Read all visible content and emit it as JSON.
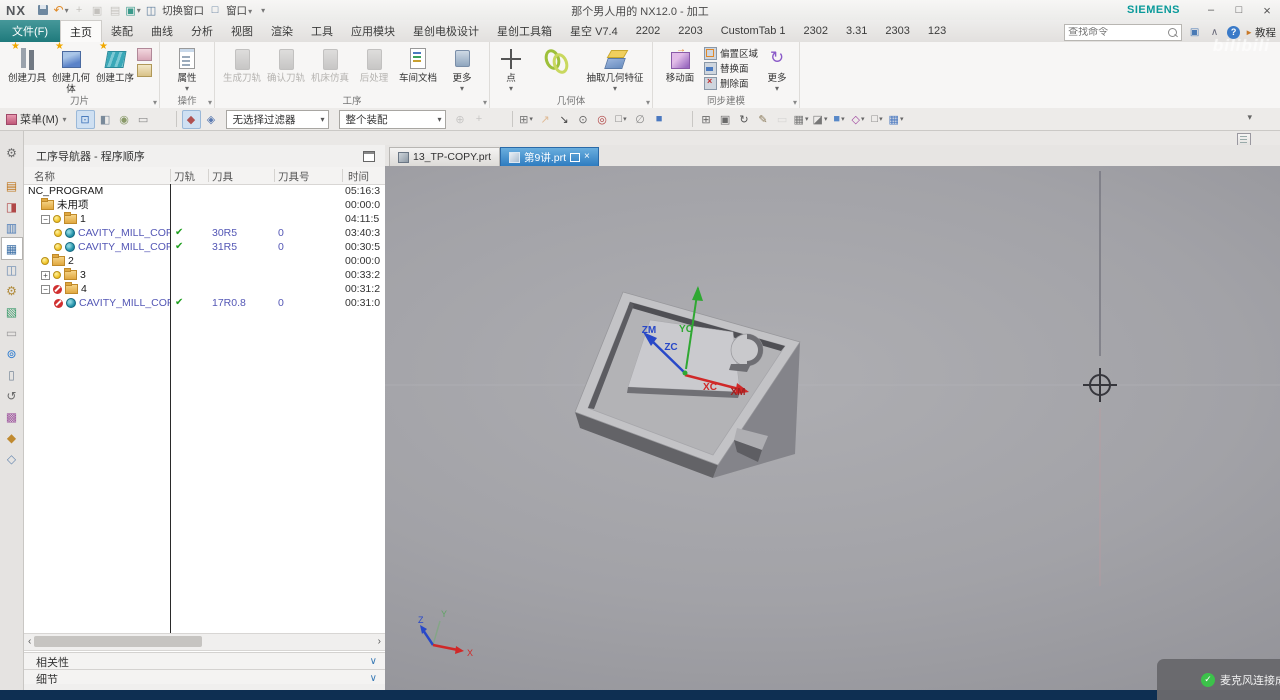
{
  "titlebar": {
    "logo": "NX",
    "title": "那个男人用的 NX12.0 - 加工",
    "brand": "SIEMENS",
    "switch_window": "切换窗口",
    "window_menu": "窗口"
  },
  "menu": {
    "file_tab": "文件(F)",
    "tabs": [
      {
        "label": "主页",
        "active": true
      },
      {
        "label": "装配"
      },
      {
        "label": "曲线"
      },
      {
        "label": "分析"
      },
      {
        "label": "视图"
      },
      {
        "label": "渲染"
      },
      {
        "label": "工具"
      },
      {
        "label": "应用模块"
      },
      {
        "label": "星创电极设计"
      },
      {
        "label": "星创工具箱"
      },
      {
        "label": "星空 V7.4"
      },
      {
        "label": "2202"
      },
      {
        "label": "2203"
      },
      {
        "label": "CustomTab 1"
      },
      {
        "label": "2302"
      },
      {
        "label": "3.31"
      },
      {
        "label": "2303"
      },
      {
        "label": "123"
      }
    ],
    "search_placeholder": "查找命令",
    "tutorial_label": "教程"
  },
  "ribbon": {
    "blade": {
      "name": "刀片",
      "create_tool": "创建刀具",
      "create_geometry": "创建几何体",
      "create_operation": "创建工序"
    },
    "operate": {
      "name": "操作",
      "properties": "属性"
    },
    "process": {
      "name": "工序",
      "generate": "生成刀轨",
      "verify": "确认刀轨",
      "simulate": "机床仿真",
      "post": "后处理",
      "shop_doc": "车间文档",
      "more": "更多"
    },
    "geometry": {
      "name": "几何体",
      "point": "点",
      "wave": "WAVE 几何链接器",
      "extract": "抽取几何特征"
    },
    "sync": {
      "name": "同步建模",
      "move_face": "移动面",
      "offset_region": "偏置区域",
      "replace_face": "替换面",
      "delete_face": "删除面",
      "more": "更多"
    }
  },
  "toolbar": {
    "menu_label": "菜单(M)",
    "filter1": "无选择过滤器",
    "filter2": "整个装配",
    "icons_a": [
      {
        "n": "snap-point-icon",
        "g": "⊡",
        "c": "#3a70b8",
        "hl": true
      },
      {
        "n": "select-scope-icon",
        "g": "◧",
        "c": "#7a8a9a"
      },
      {
        "n": "highlight-select-icon",
        "g": "◉",
        "c": "#8a9a6a"
      },
      {
        "n": "lasso-select-icon",
        "g": "▭",
        "c": "#888888"
      },
      {
        "sep": true
      },
      {
        "n": "snap-midpoint-icon",
        "g": "◆",
        "c": "#b05050",
        "hl": true
      },
      {
        "n": "snap-quadrant-icon",
        "g": "◈",
        "c": "#5878b0"
      }
    ],
    "icons_b": [
      {
        "n": "derived-point-icon",
        "g": "⊕",
        "c": "#999999",
        "dis": true
      },
      {
        "n": "measure-icon",
        "g": "+",
        "c": "#999999",
        "dis": true
      },
      {
        "sep": true
      },
      {
        "n": "plus-box-icon",
        "g": "⊞",
        "c": "#777777",
        "dd": true
      },
      {
        "n": "orange-arrow-icon",
        "g": "↗",
        "c": "#d08030",
        "dis": true
      },
      {
        "n": "pick-arrow-icon",
        "g": "↘",
        "c": "#444444"
      },
      {
        "n": "circle-center-icon",
        "g": "⊙",
        "c": "#666666"
      },
      {
        "n": "point-target-icon",
        "g": "◎",
        "c": "#b04040"
      },
      {
        "n": "dashed-rect-icon",
        "g": "□",
        "c": "#777777",
        "dd": true
      },
      {
        "n": "show-hide-icon",
        "g": "∅",
        "c": "#888888"
      },
      {
        "n": "solid-cube-icon",
        "g": "■",
        "c": "#4a78c0"
      },
      {
        "sep": true
      },
      {
        "n": "zoom-window-icon",
        "g": "⊞",
        "c": "#6a6a6a"
      },
      {
        "n": "fit-view-icon",
        "g": "▣",
        "c": "#6a6a6a"
      },
      {
        "n": "rotate-view-icon",
        "g": "↻",
        "c": "#555555"
      },
      {
        "n": "brush-icon",
        "g": "✎",
        "c": "#8a7a5a"
      },
      {
        "n": "ghost-rect-icon",
        "g": "▭",
        "c": "#bbbbbb",
        "dis": true
      },
      {
        "n": "grid-table-icon",
        "g": "▦",
        "c": "#777777",
        "dd": true
      },
      {
        "n": "clip-section-icon",
        "g": "◪",
        "c": "#777777",
        "dd": true
      },
      {
        "n": "shaded-view-icon",
        "g": "■",
        "c": "#5888c8",
        "dd": true
      },
      {
        "n": "render-style-icon",
        "g": "◇",
        "c": "#a048a0",
        "dd": true
      },
      {
        "n": "window-style-icon",
        "g": "□",
        "c": "#777777",
        "dd": true
      },
      {
        "n": "layout-icon",
        "g": "▦",
        "c": "#4a78c0",
        "dd": true
      }
    ]
  },
  "resource_bar": {
    "icons": [
      {
        "n": "gear-icon",
        "g": "⚙",
        "c": "#6a6a6a",
        "first": true
      },
      {
        "n": "assembly-navigator-icon",
        "g": "▤",
        "c": "#c07820"
      },
      {
        "n": "constraint-navigator-icon",
        "g": "◨",
        "c": "#b04848"
      },
      {
        "n": "part-navigator-icon",
        "g": "▥",
        "c": "#4a7ab5"
      },
      {
        "n": "operation-navigator-icon",
        "g": "▦",
        "c": "#3a6ea5",
        "active": true
      },
      {
        "n": "machine-tool-navigator-icon",
        "g": "◫",
        "c": "#6a8ab0"
      },
      {
        "n": "process-assistant-icon",
        "g": "⚙",
        "c": "#b08a3a"
      },
      {
        "n": "templates-icon",
        "g": "▧",
        "c": "#3a9a6a"
      },
      {
        "n": "journal-icon",
        "g": "▭",
        "c": "#9a9a9a"
      },
      {
        "n": "web-browser-icon",
        "g": "⊚",
        "c": "#2a7ad0"
      },
      {
        "n": "notes-icon",
        "g": "▯",
        "c": "#7a8a9a"
      },
      {
        "n": "history-icon",
        "g": "↺",
        "c": "#6a6a6a"
      },
      {
        "n": "palette-icon",
        "g": "▩",
        "c": "#a05aa0"
      },
      {
        "n": "roles-icon",
        "g": "◆",
        "c": "#c08a30"
      },
      {
        "n": "system-materials-icon",
        "g": "◇",
        "c": "#6a8ab0"
      }
    ]
  },
  "navigator": {
    "title": "工序导航器 - 程序顺序",
    "columns": [
      "名称",
      "刀轨",
      "刀具",
      "刀具号",
      "时间"
    ],
    "rows": [
      {
        "name": "NC_PROGRAM",
        "level": 0,
        "time": "05:16:3"
      },
      {
        "name": "未用项",
        "level": 1,
        "folder": true,
        "time": "00:00:0"
      },
      {
        "name": "1",
        "level": 1,
        "expand": "−",
        "bulb": true,
        "folder": true,
        "time": "04:11:5"
      },
      {
        "name": "CAVITY_MILL_COPY...",
        "level": 2,
        "bulb": true,
        "mill": true,
        "check": true,
        "tool": "30R5",
        "toolnum": "0",
        "time": "03:40:3",
        "link": true
      },
      {
        "name": "CAVITY_MILL_COPY",
        "level": 2,
        "bulb": true,
        "mill": true,
        "check": true,
        "tool": "31R5",
        "toolnum": "0",
        "time": "00:30:5",
        "link": true
      },
      {
        "name": "2",
        "level": 1,
        "bulb": true,
        "folder": true,
        "time": "00:00:0"
      },
      {
        "name": "3",
        "level": 1,
        "expand": "+",
        "bulb": true,
        "folder": true,
        "time": "00:33:2"
      },
      {
        "name": "4",
        "level": 1,
        "expand": "−",
        "noentry": true,
        "folder": true,
        "time": "00:31:2"
      },
      {
        "name": "CAVITY_MILL_COPY...",
        "level": 2,
        "noentry": true,
        "mill": true,
        "check": true,
        "tool": "17R0.8",
        "toolnum": "0",
        "time": "00:31:0",
        "link": true
      }
    ],
    "sections": [
      "相关性",
      "细节"
    ]
  },
  "file_tabs": {
    "tab1": "13_TP-COPY.prt",
    "tab2": "第9讲.prt"
  },
  "viewport": {
    "wcs": {
      "zm": "ZM",
      "zc": "ZC",
      "yc": "YC",
      "xc": "XC",
      "xm": "XM"
    },
    "triad": {
      "x": "X",
      "y": "Y",
      "z": "Z"
    },
    "watermark": "bilibili",
    "notification": "麦克风连接成"
  },
  "colors": {
    "siemens_teal": "#0a9a9a",
    "file_menu_teal": "#2e8f8f",
    "active_doc_tab_blue": "#3f86c6",
    "link_text": "#5356b5",
    "check_green": "#21a021",
    "no_entry_red": "#cc2a2a",
    "status_bar_navy": "#0e2f52",
    "viewport_gray": "#9c9ca2"
  }
}
